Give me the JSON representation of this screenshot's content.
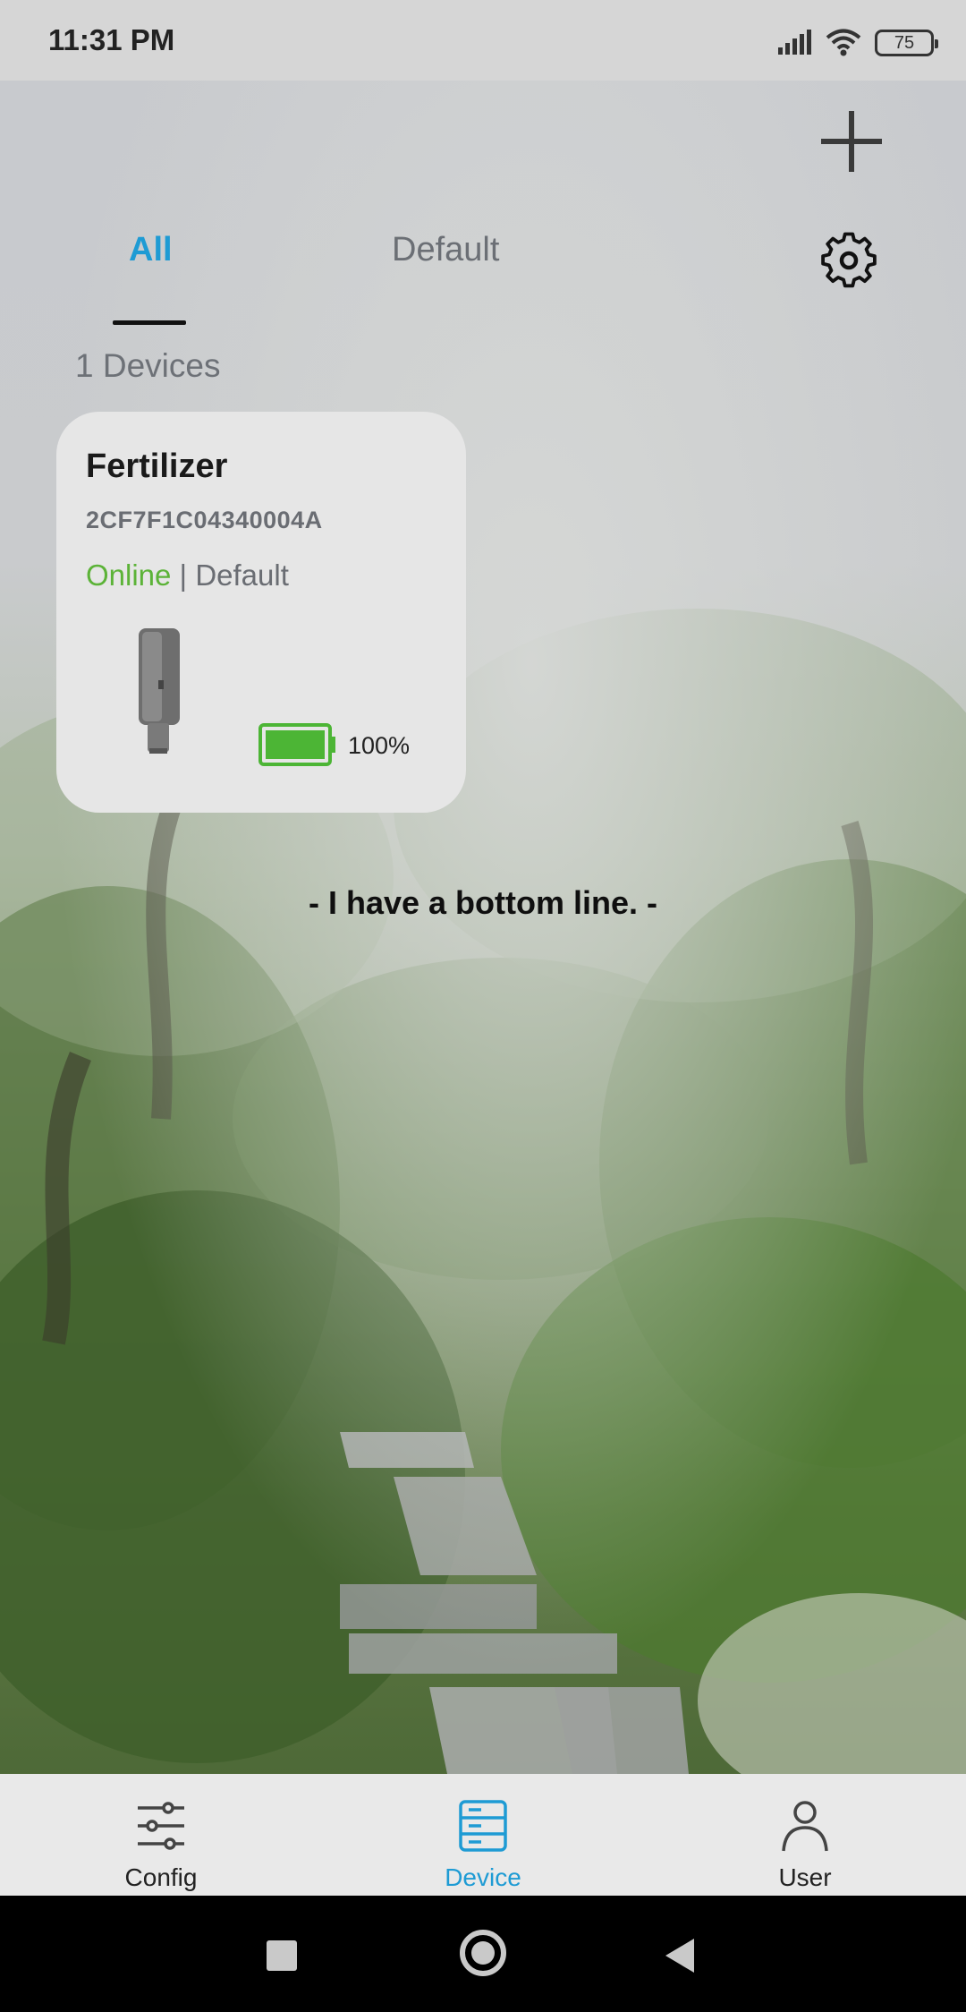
{
  "status_bar": {
    "time": "11:31 PM",
    "battery_level": "75",
    "icons": [
      "signal-icon",
      "wifi-icon",
      "battery-icon"
    ]
  },
  "header": {
    "tabs": [
      {
        "label": "All",
        "active": true
      },
      {
        "label": "Default",
        "active": false
      }
    ],
    "add_icon": "plus-icon",
    "settings_icon": "gear-icon"
  },
  "device_count_label": "1 Devices",
  "device": {
    "name": "Fertilizer",
    "id": "2CF7F1C04340004A",
    "status": "Online",
    "separator": " | ",
    "group": "Default",
    "battery_percent": "100%",
    "battery_level": 1.0
  },
  "bottom_line_text": "- I have a bottom line. -",
  "bottom_nav": {
    "items": [
      {
        "label": "Config",
        "icon": "sliders-icon",
        "active": false
      },
      {
        "label": "Device",
        "icon": "server-icon",
        "active": true
      },
      {
        "label": "User",
        "icon": "person-icon",
        "active": false
      }
    ]
  },
  "colors": {
    "accent": "#1e9bd4",
    "online": "#5cb338",
    "battery": "#4cb535"
  }
}
